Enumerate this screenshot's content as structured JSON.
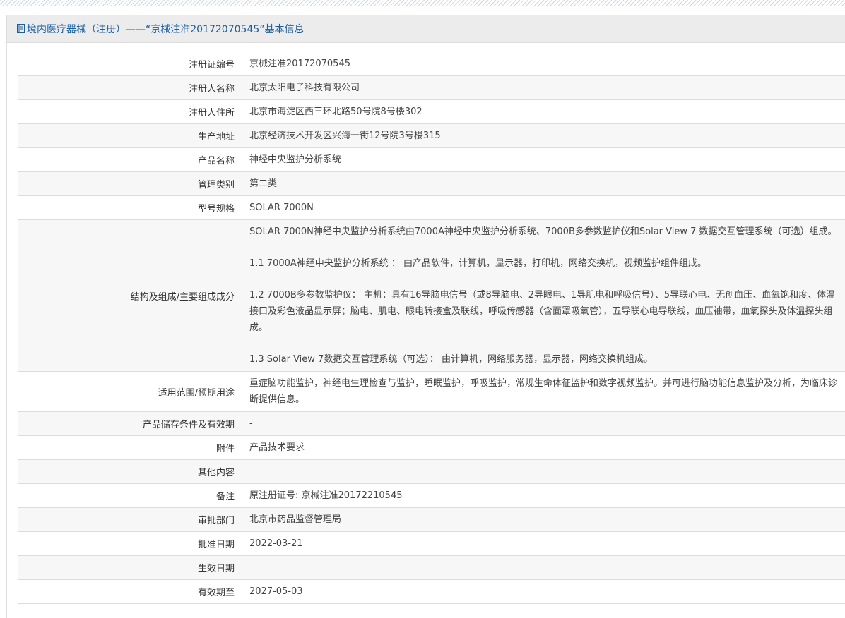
{
  "header": {
    "title": "境内医疗器械（注册）——“京械注准20172070545”基本信息"
  },
  "rows": [
    {
      "label": "注册证编号",
      "value": [
        "京械注准20172070545"
      ]
    },
    {
      "label": "注册人名称",
      "value": [
        "北京太阳电子科技有限公司"
      ]
    },
    {
      "label": "注册人住所",
      "value": [
        "北京市海淀区西三环北路50号院8号楼302"
      ]
    },
    {
      "label": "生产地址",
      "value": [
        "北京经济技术开发区兴海一街12号院3号楼315"
      ]
    },
    {
      "label": "产品名称",
      "value": [
        "神经中央监护分析系统"
      ]
    },
    {
      "label": "管理类别",
      "value": [
        "第二类"
      ]
    },
    {
      "label": "型号规格",
      "value": [
        "SOLAR 7000N"
      ]
    },
    {
      "label": "结构及组成/主要组成成分",
      "value": [
        "SOLAR 7000N神经中央监护分析系统由7000A神经中央监护分析系统、7000B多参数监护仪和Solar View 7 数据交互管理系统（可选）组成。",
        "1.1 7000A神经中央监护分析系统 ： 由产品软件，计算机，显示器，打印机，网络交换机，视频监护组件组成。",
        "1.2 7000B多参数监护仪： 主机：具有16导脑电信号（或8导脑电、2导眼电、1导肌电和呼吸信号）、5导联心电、无创血压、血氧饱和度、体温接口及彩色液晶显示屏；脑电、肌电、眼电转接盒及联线，呼吸传感器（含面罩吸氧管），五导联心电导联线，血压袖带，血氧探头及体温探头组成。",
        "1.3 Solar View 7数据交互管理系统（可选）： 由计算机，网络服务器，显示器，网络交换机组成。"
      ]
    },
    {
      "label": "适用范围/预期用途",
      "value": [
        "重症脑功能监护，神经电生理检查与监护，睡眠监护，呼吸监护，常规生命体征监护和数字视频监护。并可进行脑功能信息监护及分析，为临床诊断提供信息。"
      ]
    },
    {
      "label": "产品储存条件及有效期",
      "value": [
        "-"
      ]
    },
    {
      "label": "附件",
      "value": [
        "产品技术要求"
      ]
    },
    {
      "label": "其他内容",
      "value": [
        ""
      ]
    },
    {
      "label": "备注",
      "value": [
        "原注册证号: 京械注准20172210545"
      ]
    },
    {
      "label": "审批部门",
      "value": [
        "北京市药品监督管理局"
      ]
    },
    {
      "label": "批准日期",
      "value": [
        "2022-03-21"
      ]
    },
    {
      "label": "生效日期",
      "value": [
        ""
      ]
    },
    {
      "label": "有效期至",
      "value": [
        "2027-05-03"
      ]
    }
  ],
  "colors": {
    "header_text": "#1a5ea6",
    "header_bg": "#ececec",
    "border": "#dddddd",
    "stripe_bg": "#f7f7f7"
  },
  "icons": {
    "header_icon": "document-icon"
  }
}
